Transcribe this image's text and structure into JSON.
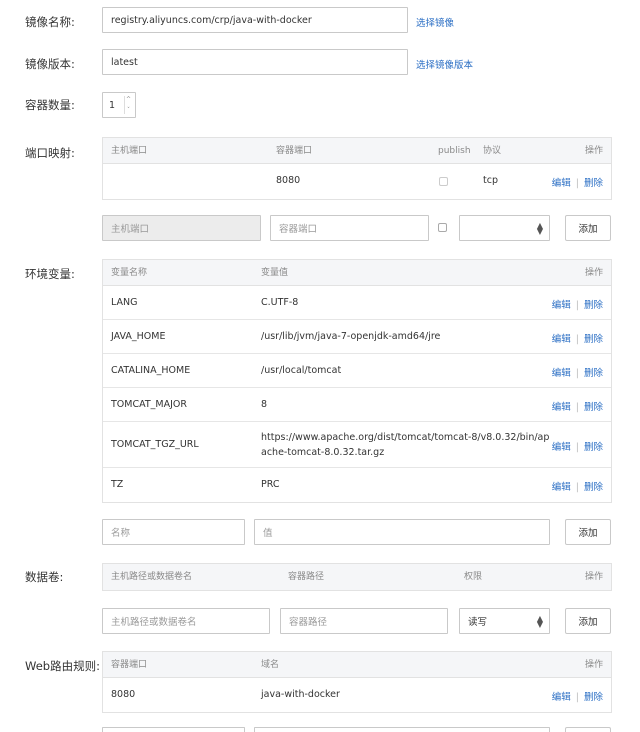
{
  "image": {
    "label": "镜像名称:",
    "value": "registry.aliyuncs.com/crp/java-with-docker",
    "action": "选择镜像"
  },
  "version": {
    "label": "镜像版本:",
    "value": "latest",
    "action": "选择镜像版本"
  },
  "count": {
    "label": "容器数量:",
    "value": "1"
  },
  "ports": {
    "label": "端口映射:",
    "headers": {
      "host": "主机端口",
      "container": "容器端口",
      "publish": "publish",
      "protocol": "协议",
      "ops": "操作"
    },
    "rows": [
      {
        "host": "",
        "container": "8080",
        "protocol": "tcp"
      }
    ],
    "form": {
      "host_placeholder": "主机端口",
      "container_placeholder": "容器端口",
      "protocol_value": ""
    }
  },
  "env": {
    "label": "环境变量:",
    "headers": {
      "name": "变量名称",
      "value": "变量值",
      "ops": "操作"
    },
    "rows": [
      {
        "name": "LANG",
        "value": "C.UTF-8"
      },
      {
        "name": "JAVA_HOME",
        "value": "/usr/lib/jvm/java-7-openjdk-amd64/jre"
      },
      {
        "name": "CATALINA_HOME",
        "value": "/usr/local/tomcat"
      },
      {
        "name": "TOMCAT_MAJOR",
        "value": "8"
      },
      {
        "name": "TOMCAT_TGZ_URL",
        "value_line1": "https://www.apache.org/dist/tomcat/tomcat-8/v8.0.32/bin/ap",
        "value_line2": "ache-tomcat-8.0.32.tar.gz"
      },
      {
        "name": "TZ",
        "value": "PRC"
      }
    ],
    "form": {
      "name_placeholder": "名称",
      "value_placeholder": "值"
    }
  },
  "volumes": {
    "label": "数据卷:",
    "headers": {
      "host": "主机路径或数据卷名",
      "container": "容器路径",
      "perm": "权限",
      "ops": "操作"
    },
    "form": {
      "host_placeholder": "主机路径或数据卷名",
      "container_placeholder": "容器路径",
      "perm_value": "读写"
    }
  },
  "routes": {
    "label": "Web路由规则:",
    "headers": {
      "port": "容器端口",
      "domain": "域名",
      "ops": "操作"
    },
    "rows": [
      {
        "port": "8080",
        "domain": "java-with-docker"
      }
    ]
  },
  "common": {
    "edit": "编辑",
    "delete": "删除",
    "sep": "|",
    "add": "添加"
  }
}
